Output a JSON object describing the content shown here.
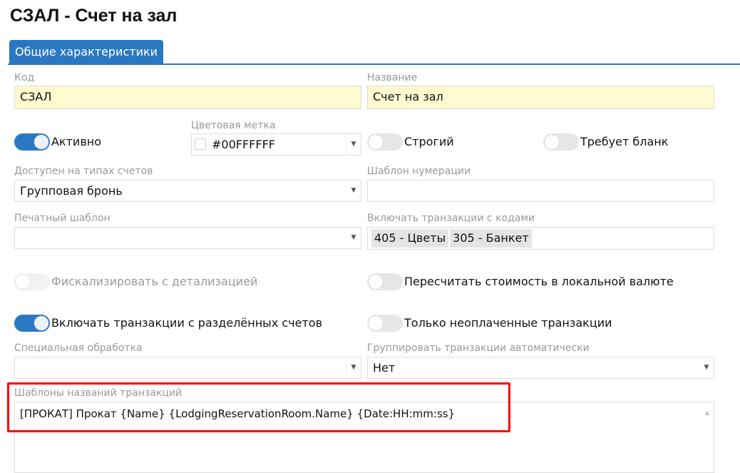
{
  "title": "СЗАЛ - Счет на зал",
  "tab": "Общие характеристики",
  "code": {
    "label": "Код",
    "value": "СЗАЛ"
  },
  "name": {
    "label": "Название",
    "value": "Счет на зал"
  },
  "active": {
    "label": "Активно",
    "on": true
  },
  "color": {
    "label": "Цветовая метка",
    "value": "#00FFFFFF"
  },
  "strict": {
    "label": "Строгий",
    "on": false
  },
  "blank": {
    "label": "Требует бланк",
    "on": false
  },
  "available": {
    "label": "Доступен на типах счетов",
    "value": "Групповая бронь"
  },
  "numbering": {
    "label": "Шаблон нумерации",
    "value": ""
  },
  "print": {
    "label": "Печатный шаблон",
    "value": ""
  },
  "codes": {
    "label": "Включать транзакции с кодами",
    "chips": [
      "405 - Цветы",
      "305 - Банкет"
    ]
  },
  "fiscal": {
    "label": "Фискализировать с детализацией",
    "on": false,
    "disabled": true
  },
  "recalc": {
    "label": "Пересчитать стоимость в локальной валюте",
    "on": false
  },
  "split": {
    "label": "Включать транзакции с разделённых счетов",
    "on": true
  },
  "unpaid": {
    "label": "Только неоплаченные транзакции",
    "on": false
  },
  "special": {
    "label": "Специальная обработка",
    "value": ""
  },
  "group": {
    "label": "Группировать транзакции автоматически",
    "value": "Нет"
  },
  "templates": {
    "label": "Шаблоны названий транзакций",
    "value": "[ПРОКАТ] Прокат {Name} {LodgingReservationRoom.Name} {Date:HH:mm:ss}"
  }
}
